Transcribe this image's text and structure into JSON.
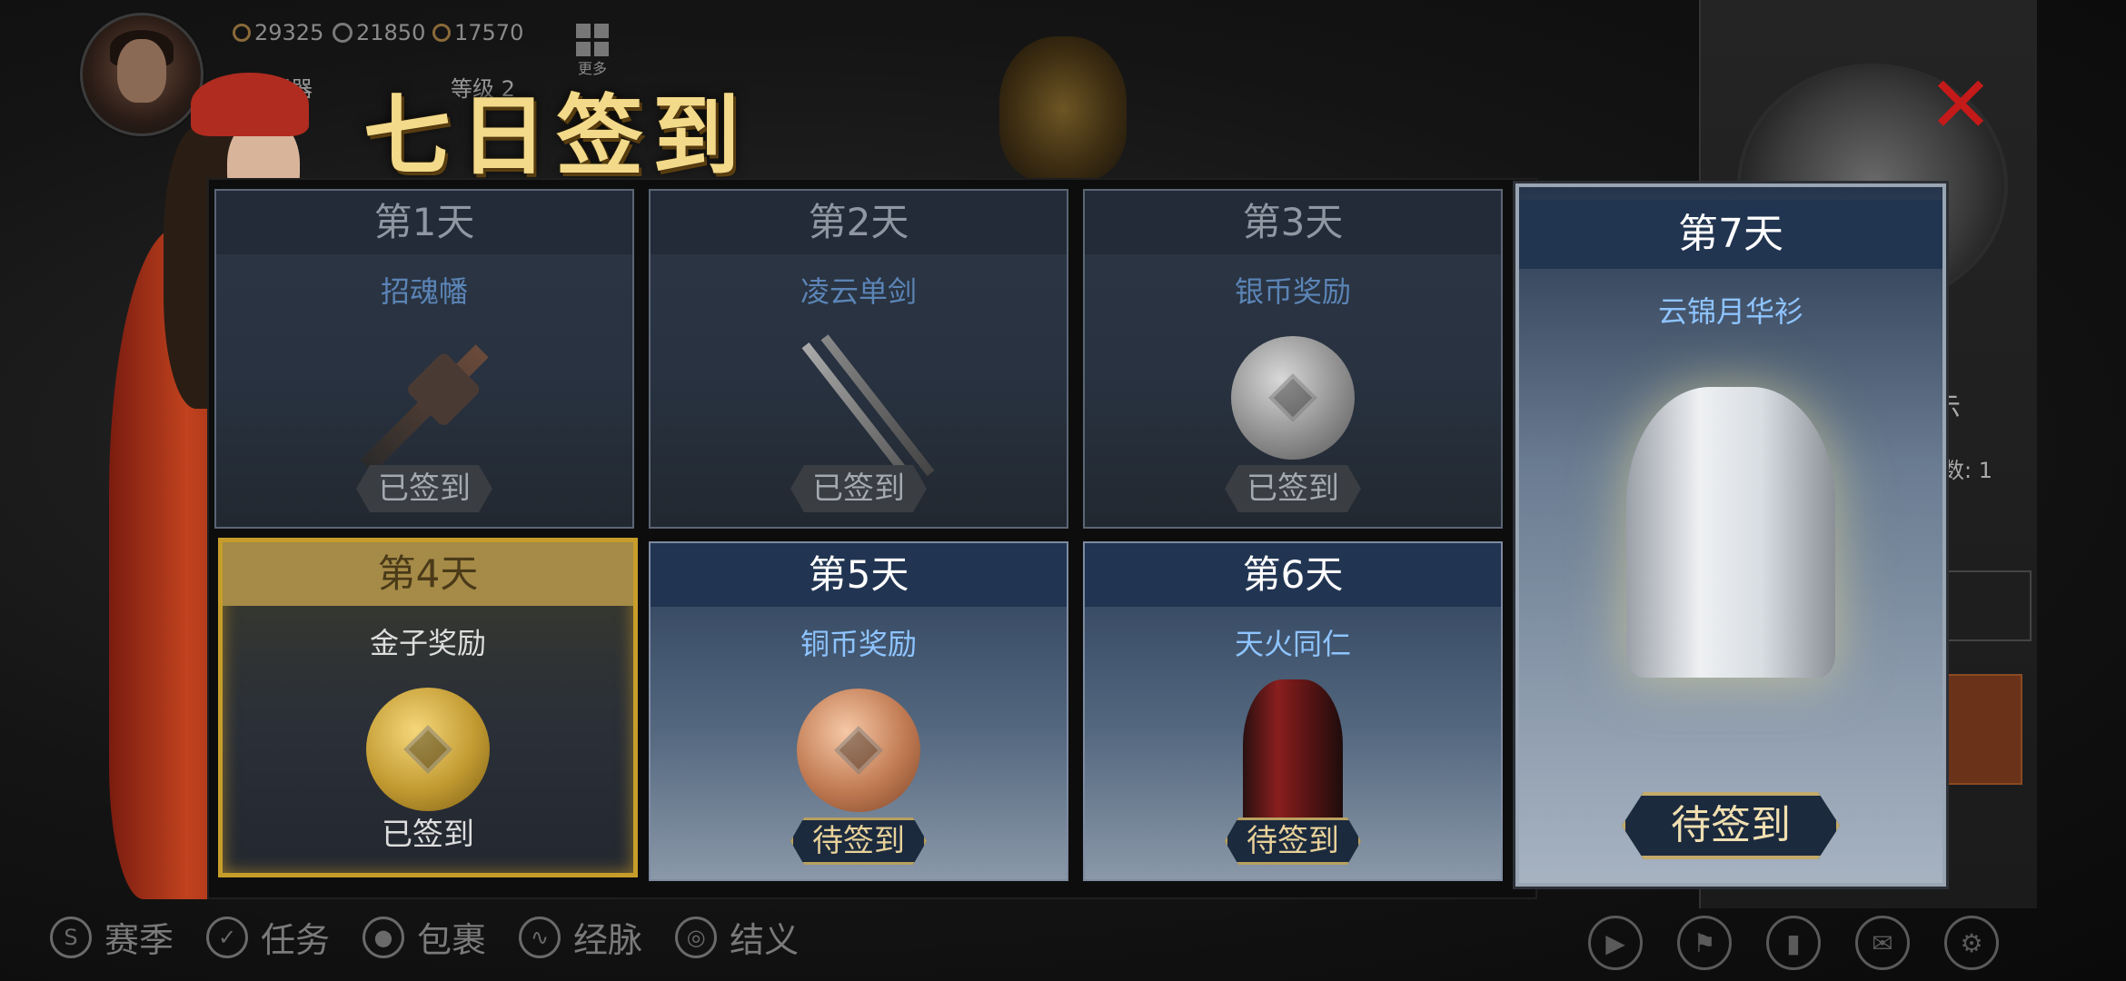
{
  "hud": {
    "currency": [
      {
        "icon": "coin-icon",
        "value": "29325"
      },
      {
        "icon": "gem-icon",
        "value": "21850"
      },
      {
        "icon": "gold-coin-icon",
        "value": "17570"
      }
    ],
    "more_label": "更多",
    "player_name": "光筹玉器",
    "level": "等级 2"
  },
  "title": "七日签到",
  "days": [
    {
      "day": "第1天",
      "item": "招魂幡",
      "status": "已签到",
      "state": "done"
    },
    {
      "day": "第2天",
      "item": "凌云单剑",
      "status": "已签到",
      "state": "done"
    },
    {
      "day": "第3天",
      "item": "银币奖励",
      "status": "已签到",
      "state": "done"
    },
    {
      "day": "第4天",
      "item": "金子奖励",
      "status": "已签到",
      "state": "today"
    },
    {
      "day": "第5天",
      "item": "铜币奖励",
      "status": "待签到",
      "state": "pending"
    },
    {
      "day": "第6天",
      "item": "天火同仁",
      "status": "待签到",
      "state": "pending"
    },
    {
      "day": "第7天",
      "item": "云锦月华衫",
      "status": "待签到",
      "state": "pending"
    }
  ],
  "right_panel": {
    "text1": "示",
    "text2": "数: 1"
  },
  "bottom_nav": [
    {
      "icon": "season-icon",
      "label": "赛季"
    },
    {
      "icon": "task-icon",
      "label": "任务"
    },
    {
      "icon": "bag-icon",
      "label": "包裹"
    },
    {
      "icon": "meridian-icon",
      "label": "经脉"
    },
    {
      "icon": "sworn-icon",
      "label": "结义"
    }
  ],
  "bottom_right_icons": [
    "video-icon",
    "guild-icon",
    "ranking-icon",
    "mail-icon",
    "settings-icon"
  ],
  "colors": {
    "accent_gold": "#c79d2a",
    "pending_blue": "#8ec4ff",
    "close_red": "#c41a1a"
  }
}
